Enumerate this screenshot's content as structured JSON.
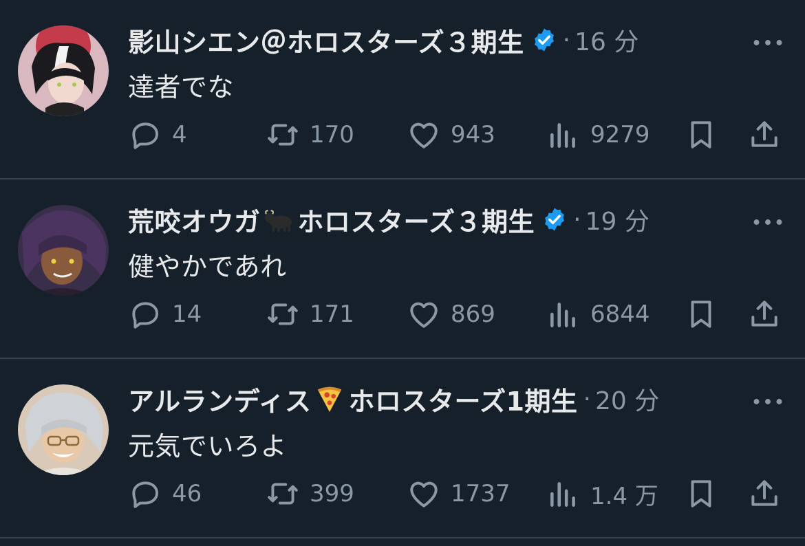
{
  "tweets": [
    {
      "author": "影山シエン＠ホロスターズ３期生",
      "author_emoji": "",
      "verified": true,
      "separator": "·",
      "time": "16 分",
      "text": "達者でな",
      "replies": "4",
      "retweets": "170",
      "likes": "943",
      "views": "9279"
    },
    {
      "author": "荒咬オウガ",
      "author_suffix": "ホロスターズ３期生",
      "author_emoji": "bull-emoji",
      "verified": true,
      "separator": "·",
      "time": "19 分",
      "text": "健やかであれ",
      "replies": "14",
      "retweets": "171",
      "likes": "869",
      "views": "6844"
    },
    {
      "author": "アルランディス",
      "author_suffix": "ホロスターズ1期生",
      "author_emoji": "pizza-emoji",
      "verified": false,
      "separator": "·",
      "time": "20 分",
      "text": "元気でいろよ",
      "replies": "46",
      "retweets": "399",
      "likes": "1737",
      "views": "1.4 万"
    }
  ],
  "colors": {
    "background": "#15202b",
    "text": "#e7e9ea",
    "muted": "#8b98a5",
    "divider": "#38444d",
    "verified": "#1d9bf0"
  },
  "icons": [
    "reply-icon",
    "retweet-icon",
    "like-icon",
    "views-icon",
    "bookmark-icon",
    "share-icon",
    "more-icon",
    "verified-icon"
  ]
}
